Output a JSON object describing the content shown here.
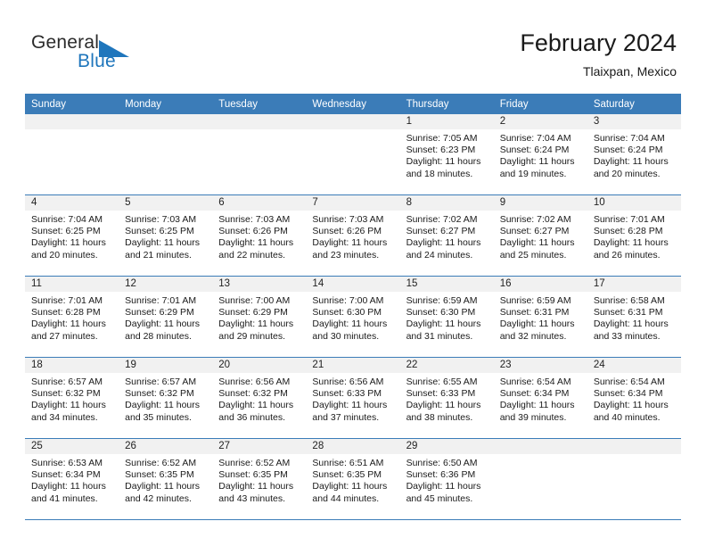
{
  "brand": {
    "name_part1": "General",
    "name_part2": "Blue",
    "mark": "triangle-logo",
    "accent_color": "#1f76bc"
  },
  "header": {
    "title": "February 2024",
    "location": "Tlaixpan, Mexico"
  },
  "calendar": {
    "header_bg": "#3b7cb8",
    "daynum_bg": "#f1f1f1",
    "weekday_headers": [
      "Sunday",
      "Monday",
      "Tuesday",
      "Wednesday",
      "Thursday",
      "Friday",
      "Saturday"
    ],
    "weeks": [
      [
        {
          "day": "",
          "sunrise": "",
          "sunset": "",
          "daylight1": "",
          "daylight2": ""
        },
        {
          "day": "",
          "sunrise": "",
          "sunset": "",
          "daylight1": "",
          "daylight2": ""
        },
        {
          "day": "",
          "sunrise": "",
          "sunset": "",
          "daylight1": "",
          "daylight2": ""
        },
        {
          "day": "",
          "sunrise": "",
          "sunset": "",
          "daylight1": "",
          "daylight2": ""
        },
        {
          "day": "1",
          "sunrise": "Sunrise: 7:05 AM",
          "sunset": "Sunset: 6:23 PM",
          "daylight1": "Daylight: 11 hours",
          "daylight2": "and 18 minutes."
        },
        {
          "day": "2",
          "sunrise": "Sunrise: 7:04 AM",
          "sunset": "Sunset: 6:24 PM",
          "daylight1": "Daylight: 11 hours",
          "daylight2": "and 19 minutes."
        },
        {
          "day": "3",
          "sunrise": "Sunrise: 7:04 AM",
          "sunset": "Sunset: 6:24 PM",
          "daylight1": "Daylight: 11 hours",
          "daylight2": "and 20 minutes."
        }
      ],
      [
        {
          "day": "4",
          "sunrise": "Sunrise: 7:04 AM",
          "sunset": "Sunset: 6:25 PM",
          "daylight1": "Daylight: 11 hours",
          "daylight2": "and 20 minutes."
        },
        {
          "day": "5",
          "sunrise": "Sunrise: 7:03 AM",
          "sunset": "Sunset: 6:25 PM",
          "daylight1": "Daylight: 11 hours",
          "daylight2": "and 21 minutes."
        },
        {
          "day": "6",
          "sunrise": "Sunrise: 7:03 AM",
          "sunset": "Sunset: 6:26 PM",
          "daylight1": "Daylight: 11 hours",
          "daylight2": "and 22 minutes."
        },
        {
          "day": "7",
          "sunrise": "Sunrise: 7:03 AM",
          "sunset": "Sunset: 6:26 PM",
          "daylight1": "Daylight: 11 hours",
          "daylight2": "and 23 minutes."
        },
        {
          "day": "8",
          "sunrise": "Sunrise: 7:02 AM",
          "sunset": "Sunset: 6:27 PM",
          "daylight1": "Daylight: 11 hours",
          "daylight2": "and 24 minutes."
        },
        {
          "day": "9",
          "sunrise": "Sunrise: 7:02 AM",
          "sunset": "Sunset: 6:27 PM",
          "daylight1": "Daylight: 11 hours",
          "daylight2": "and 25 minutes."
        },
        {
          "day": "10",
          "sunrise": "Sunrise: 7:01 AM",
          "sunset": "Sunset: 6:28 PM",
          "daylight1": "Daylight: 11 hours",
          "daylight2": "and 26 minutes."
        }
      ],
      [
        {
          "day": "11",
          "sunrise": "Sunrise: 7:01 AM",
          "sunset": "Sunset: 6:28 PM",
          "daylight1": "Daylight: 11 hours",
          "daylight2": "and 27 minutes."
        },
        {
          "day": "12",
          "sunrise": "Sunrise: 7:01 AM",
          "sunset": "Sunset: 6:29 PM",
          "daylight1": "Daylight: 11 hours",
          "daylight2": "and 28 minutes."
        },
        {
          "day": "13",
          "sunrise": "Sunrise: 7:00 AM",
          "sunset": "Sunset: 6:29 PM",
          "daylight1": "Daylight: 11 hours",
          "daylight2": "and 29 minutes."
        },
        {
          "day": "14",
          "sunrise": "Sunrise: 7:00 AM",
          "sunset": "Sunset: 6:30 PM",
          "daylight1": "Daylight: 11 hours",
          "daylight2": "and 30 minutes."
        },
        {
          "day": "15",
          "sunrise": "Sunrise: 6:59 AM",
          "sunset": "Sunset: 6:30 PM",
          "daylight1": "Daylight: 11 hours",
          "daylight2": "and 31 minutes."
        },
        {
          "day": "16",
          "sunrise": "Sunrise: 6:59 AM",
          "sunset": "Sunset: 6:31 PM",
          "daylight1": "Daylight: 11 hours",
          "daylight2": "and 32 minutes."
        },
        {
          "day": "17",
          "sunrise": "Sunrise: 6:58 AM",
          "sunset": "Sunset: 6:31 PM",
          "daylight1": "Daylight: 11 hours",
          "daylight2": "and 33 minutes."
        }
      ],
      [
        {
          "day": "18",
          "sunrise": "Sunrise: 6:57 AM",
          "sunset": "Sunset: 6:32 PM",
          "daylight1": "Daylight: 11 hours",
          "daylight2": "and 34 minutes."
        },
        {
          "day": "19",
          "sunrise": "Sunrise: 6:57 AM",
          "sunset": "Sunset: 6:32 PM",
          "daylight1": "Daylight: 11 hours",
          "daylight2": "and 35 minutes."
        },
        {
          "day": "20",
          "sunrise": "Sunrise: 6:56 AM",
          "sunset": "Sunset: 6:32 PM",
          "daylight1": "Daylight: 11 hours",
          "daylight2": "and 36 minutes."
        },
        {
          "day": "21",
          "sunrise": "Sunrise: 6:56 AM",
          "sunset": "Sunset: 6:33 PM",
          "daylight1": "Daylight: 11 hours",
          "daylight2": "and 37 minutes."
        },
        {
          "day": "22",
          "sunrise": "Sunrise: 6:55 AM",
          "sunset": "Sunset: 6:33 PM",
          "daylight1": "Daylight: 11 hours",
          "daylight2": "and 38 minutes."
        },
        {
          "day": "23",
          "sunrise": "Sunrise: 6:54 AM",
          "sunset": "Sunset: 6:34 PM",
          "daylight1": "Daylight: 11 hours",
          "daylight2": "and 39 minutes."
        },
        {
          "day": "24",
          "sunrise": "Sunrise: 6:54 AM",
          "sunset": "Sunset: 6:34 PM",
          "daylight1": "Daylight: 11 hours",
          "daylight2": "and 40 minutes."
        }
      ],
      [
        {
          "day": "25",
          "sunrise": "Sunrise: 6:53 AM",
          "sunset": "Sunset: 6:34 PM",
          "daylight1": "Daylight: 11 hours",
          "daylight2": "and 41 minutes."
        },
        {
          "day": "26",
          "sunrise": "Sunrise: 6:52 AM",
          "sunset": "Sunset: 6:35 PM",
          "daylight1": "Daylight: 11 hours",
          "daylight2": "and 42 minutes."
        },
        {
          "day": "27",
          "sunrise": "Sunrise: 6:52 AM",
          "sunset": "Sunset: 6:35 PM",
          "daylight1": "Daylight: 11 hours",
          "daylight2": "and 43 minutes."
        },
        {
          "day": "28",
          "sunrise": "Sunrise: 6:51 AM",
          "sunset": "Sunset: 6:35 PM",
          "daylight1": "Daylight: 11 hours",
          "daylight2": "and 44 minutes."
        },
        {
          "day": "29",
          "sunrise": "Sunrise: 6:50 AM",
          "sunset": "Sunset: 6:36 PM",
          "daylight1": "Daylight: 11 hours",
          "daylight2": "and 45 minutes."
        },
        {
          "day": "",
          "sunrise": "",
          "sunset": "",
          "daylight1": "",
          "daylight2": ""
        },
        {
          "day": "",
          "sunrise": "",
          "sunset": "",
          "daylight1": "",
          "daylight2": ""
        }
      ]
    ]
  }
}
